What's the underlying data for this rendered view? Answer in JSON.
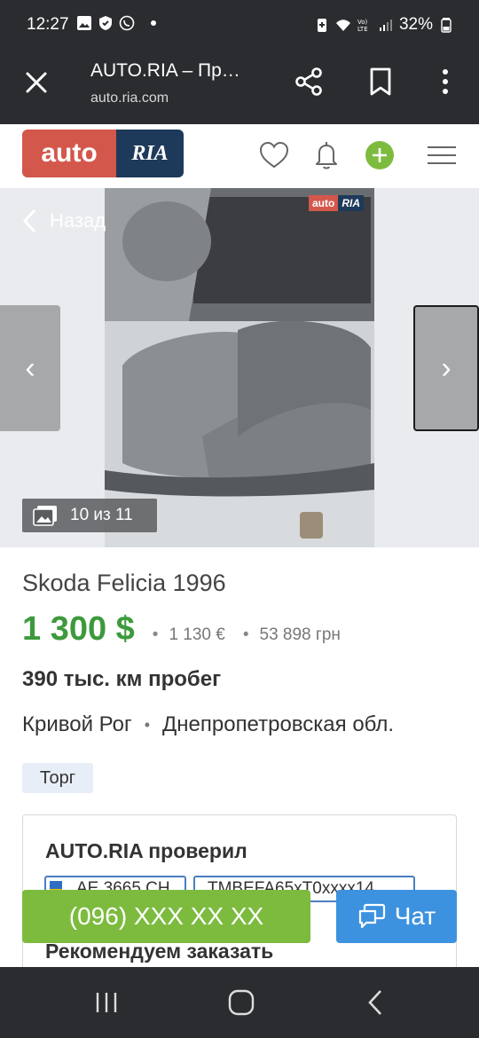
{
  "status_bar": {
    "time": "12:27",
    "battery": "32%",
    "icons": [
      "gallery-icon",
      "shield-icon",
      "viber-icon",
      "dot",
      "battery-saver-icon",
      "wifi-icon",
      "volte-icon",
      "signal-icon",
      "battery-icon"
    ]
  },
  "browser": {
    "title": "AUTO.RIA – Пр…",
    "url": "auto.ria.com",
    "icons": [
      "close-icon",
      "share-icon",
      "bookmark-icon",
      "more-icon"
    ]
  },
  "site_header": {
    "logo_auto": "auto",
    "logo_ria": "RIA",
    "icons": [
      "heart-icon",
      "bell-icon",
      "add-icon",
      "menu-icon"
    ],
    "accent_color": "#d4574c",
    "brand_dark": "#1e3a5a",
    "green": "#7dbb3f"
  },
  "gallery": {
    "back_label": "Назад",
    "counter": "10 из 11",
    "watermark_auto": "auto",
    "watermark_ria": "RIA",
    "prev_label": "‹",
    "next_label": "›"
  },
  "listing": {
    "title": "Skoda Felicia 1996",
    "price": "1 300 $",
    "price_eur": "1 130 €",
    "price_uah": "53 898 грн",
    "mileage": "390 тыс. км пробег",
    "city": "Кривой Рог",
    "region": "Днепропетровская обл.",
    "tag": "Торг"
  },
  "check_card": {
    "heading": "AUTO.RIA проверил",
    "plate": "АЕ 3665 СН",
    "vin": "TMBEFA65xT0xxxx14",
    "recommend": "Рекомендуем заказать"
  },
  "actions": {
    "phone": "(096) XXX XX XX",
    "chat": "Чат"
  },
  "android_nav": {
    "icons": [
      "recents-icon",
      "home-icon",
      "back-icon"
    ]
  }
}
